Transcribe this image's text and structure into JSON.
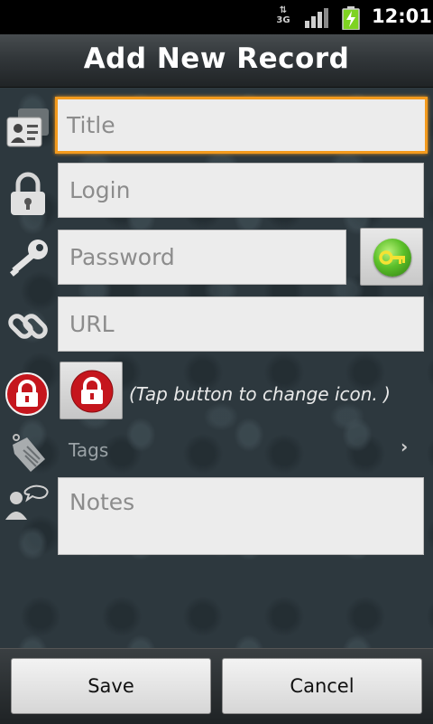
{
  "status_bar": {
    "network": "3G",
    "time": "12:01"
  },
  "header": {
    "title": "Add New Record"
  },
  "form": {
    "title_placeholder": "Title",
    "login_placeholder": "Login",
    "password_placeholder": "Password",
    "url_placeholder": "URL",
    "icon_hint": "(Tap button to change icon. )",
    "tags_label": "Tags",
    "tags_arrow": "›",
    "notes_placeholder": "Notes"
  },
  "actions": {
    "save_label": "Save",
    "cancel_label": "Cancel"
  },
  "colors": {
    "focus": "#f39a1d",
    "lock_red": "#c5161d",
    "key_green": "#5cc02a"
  },
  "icons": [
    "contact-card-icon",
    "padlock-icon",
    "key-icon",
    "link-icon",
    "red-lock-icon",
    "tag-icon",
    "person-note-icon",
    "key-generator-icon"
  ]
}
